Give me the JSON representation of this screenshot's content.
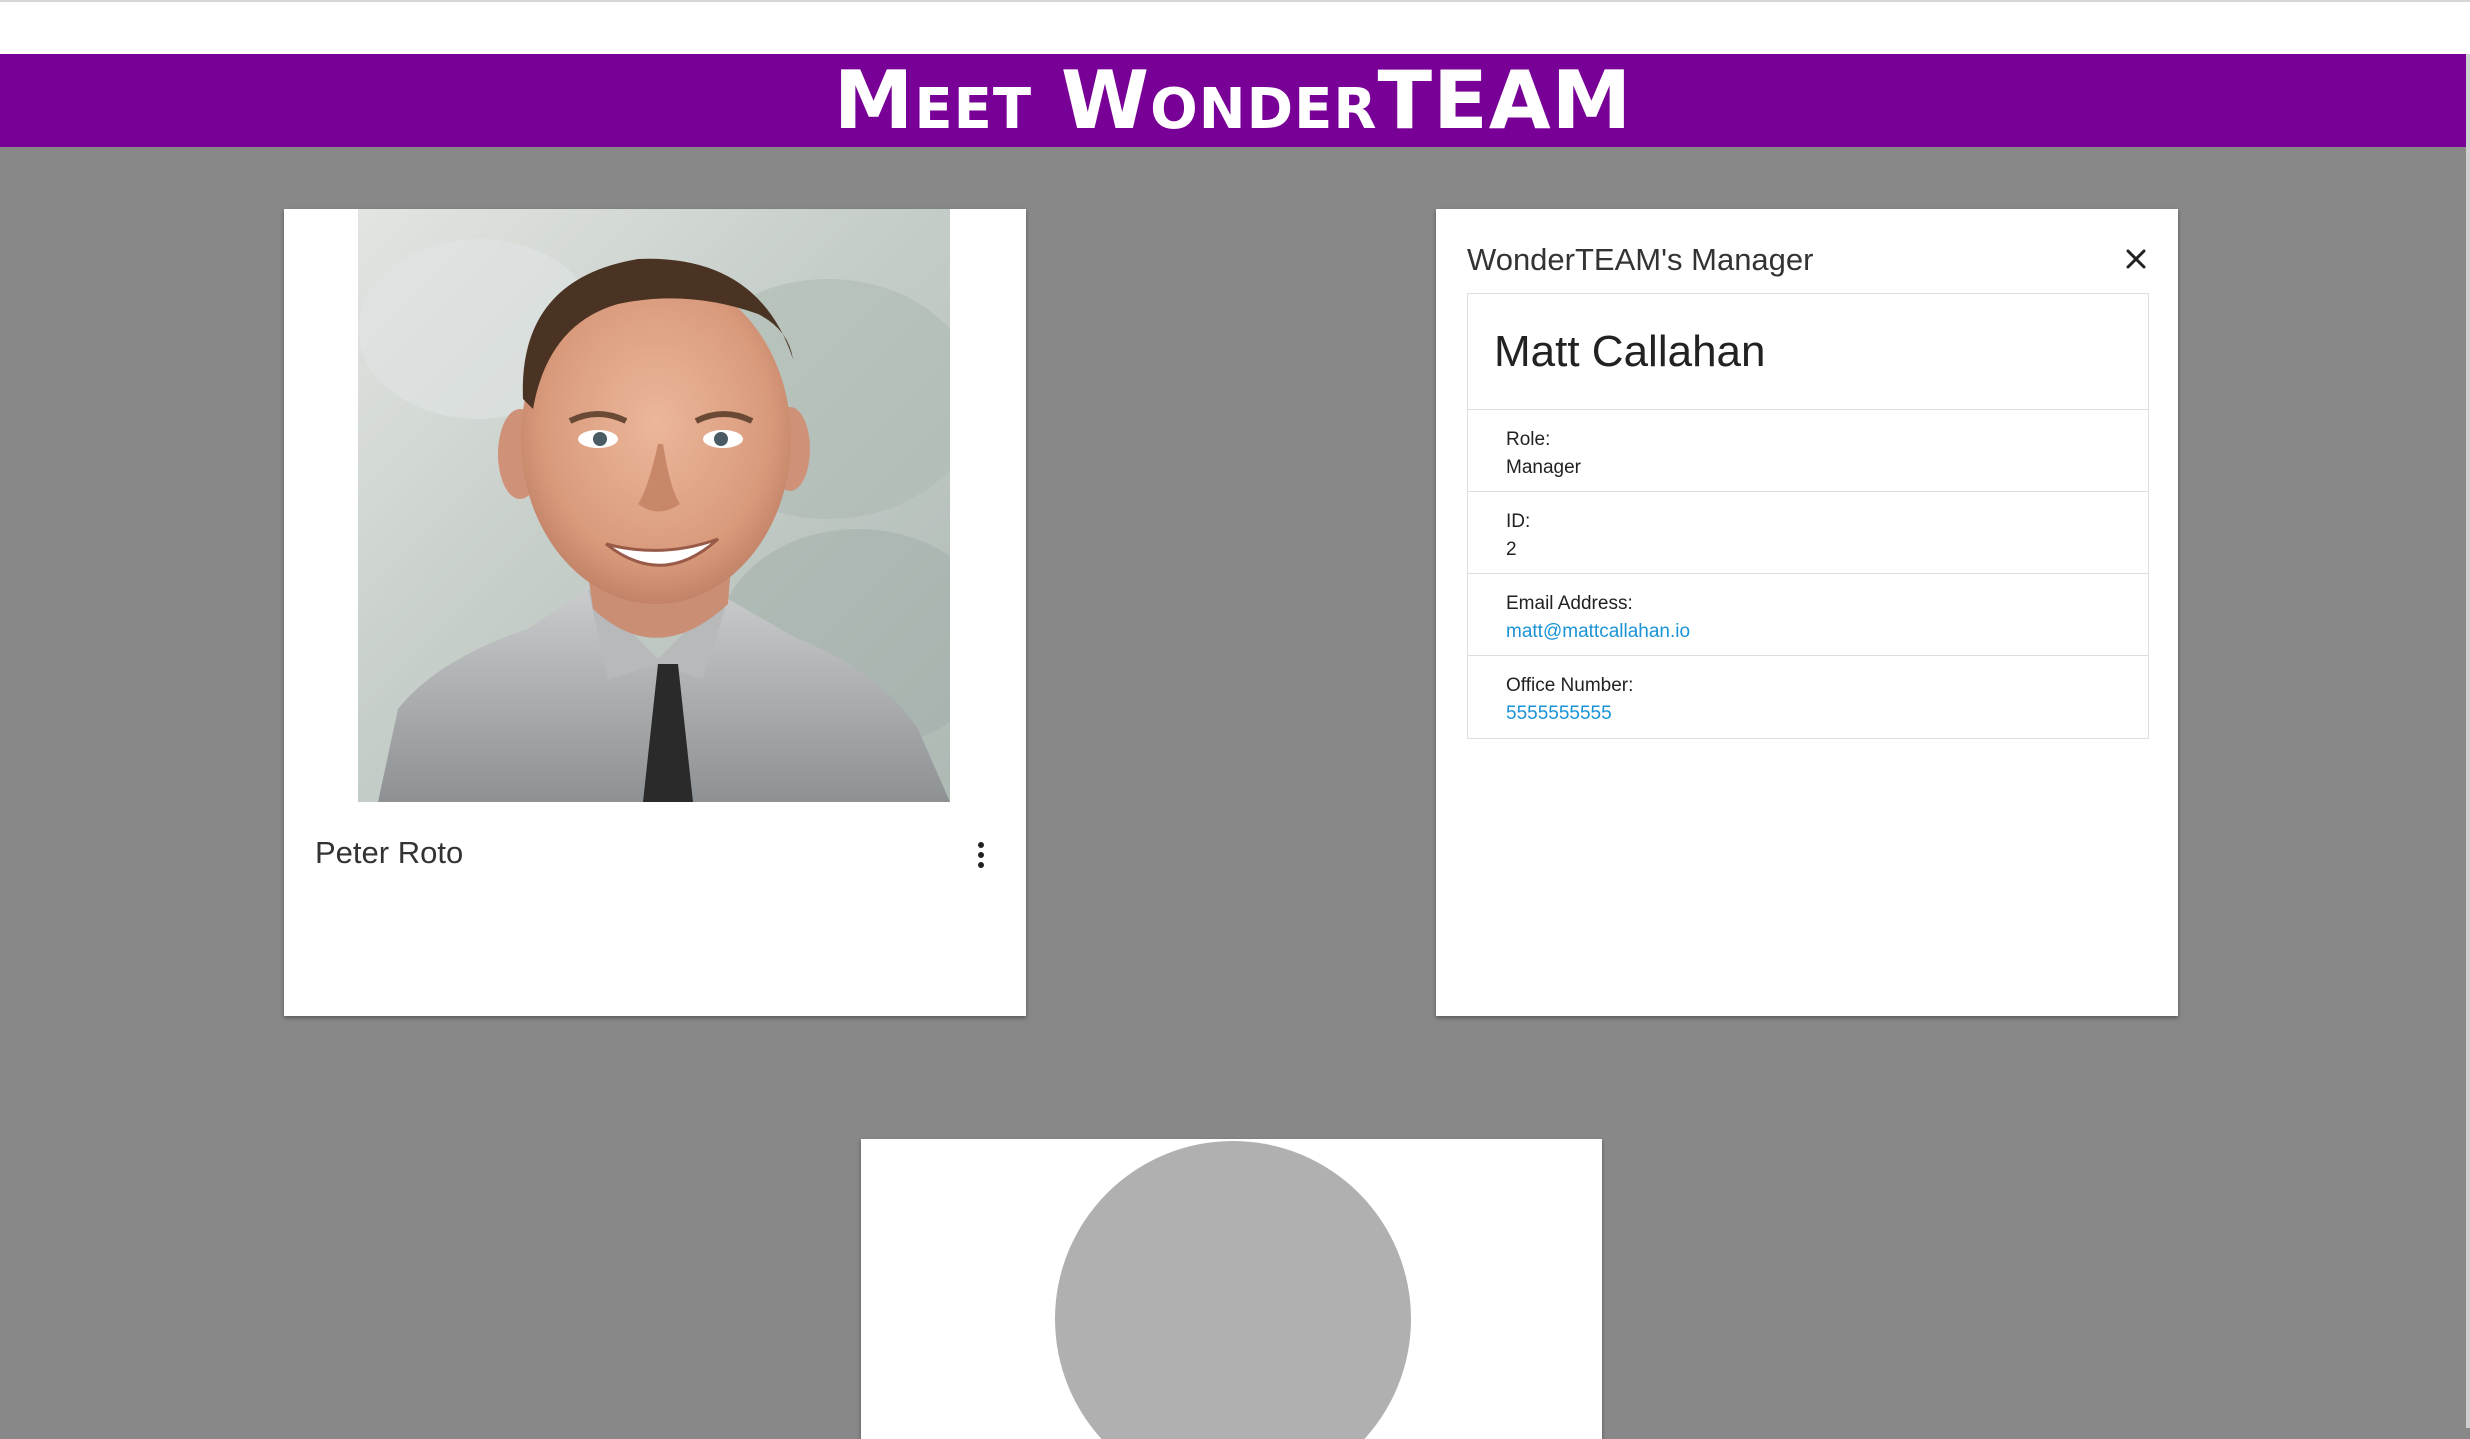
{
  "header": {
    "title": "Meet WonderTEAM"
  },
  "team_card": {
    "name": "Peter Roto",
    "photo_alt": "Peter Roto",
    "more_icon": "more-vert-icon"
  },
  "manager_dialog": {
    "title": "WonderTEAM's Manager",
    "close_icon": "close-icon",
    "name": "Matt Callahan",
    "fields": [
      {
        "label": "Role:",
        "value": "Manager"
      },
      {
        "label": "ID:",
        "value": "2"
      },
      {
        "label": "Email Address:",
        "value": "matt@mattcallahan.io"
      },
      {
        "label": "Office Number:",
        "value": "5555555555"
      }
    ]
  },
  "colors": {
    "header_bg": "#780096",
    "page_bg": "#888888",
    "link": "#1a93d6",
    "avatar_placeholder": "#b0b0b0"
  }
}
